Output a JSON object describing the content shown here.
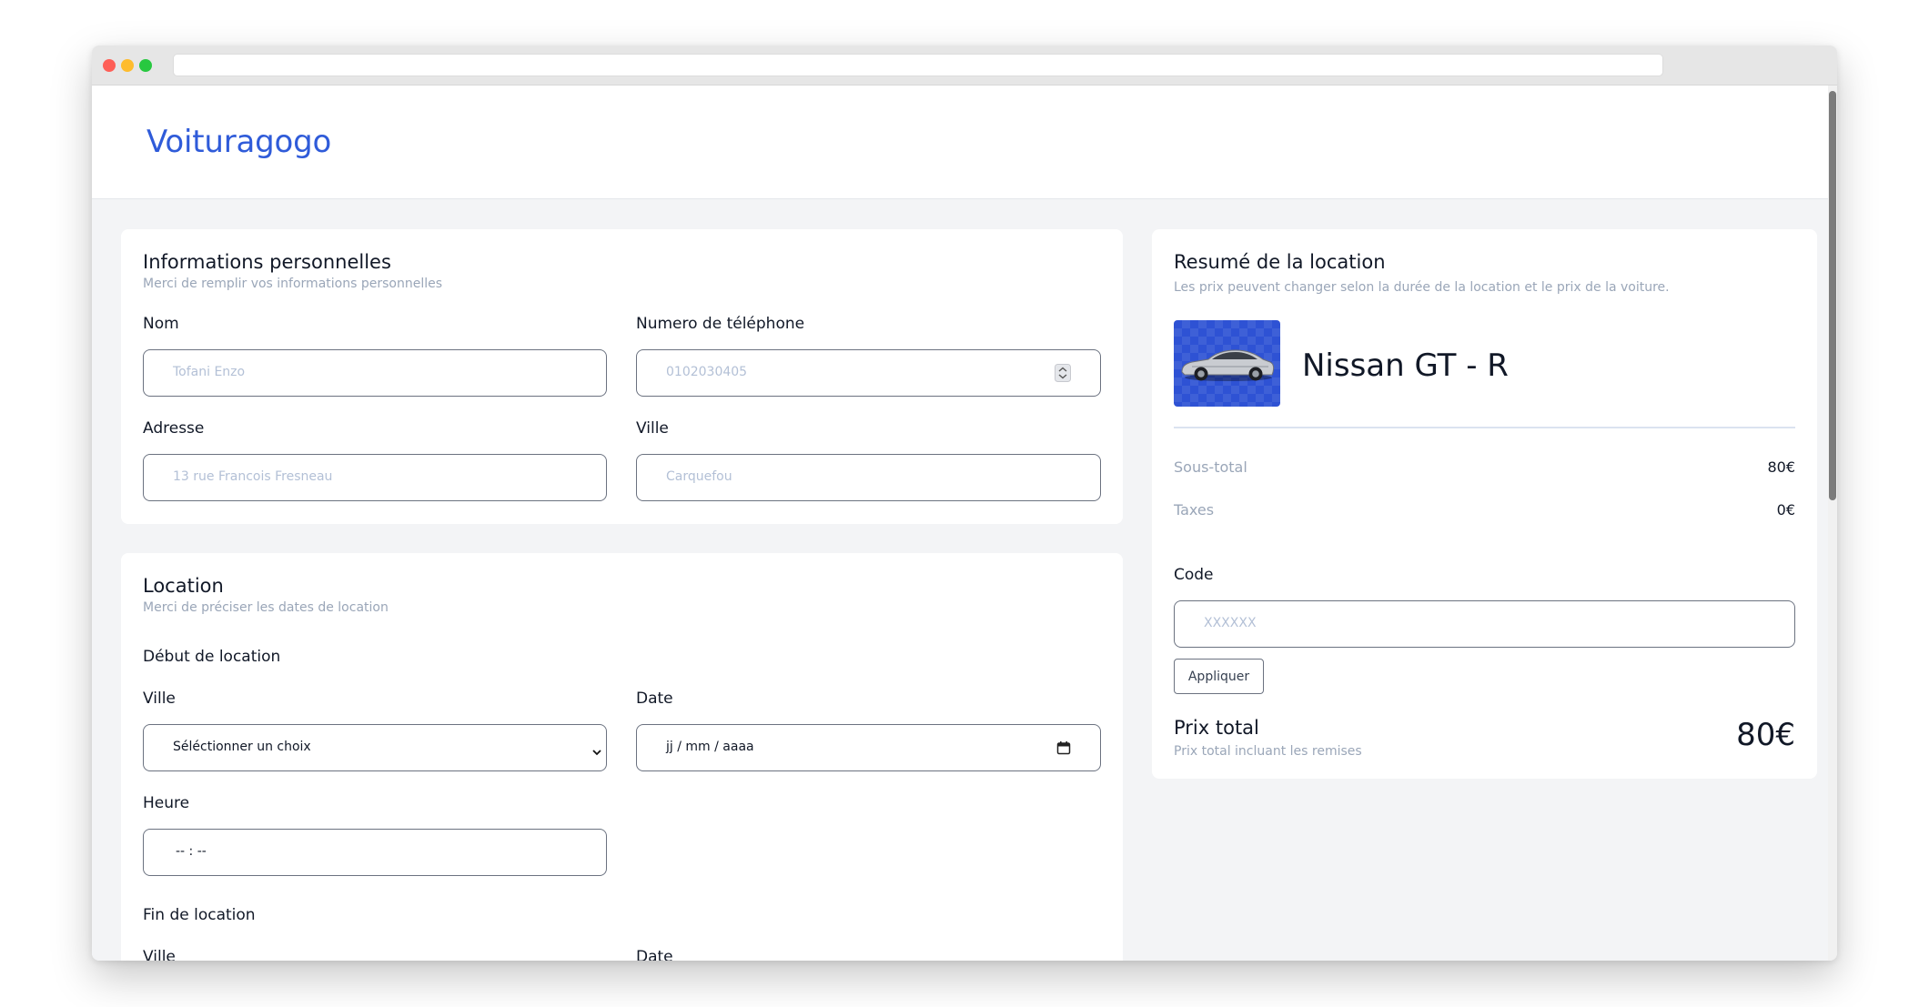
{
  "app": {
    "name": "Voituragogo",
    "brand_color": "#2f5bd9"
  },
  "personal": {
    "title": "Informations personnelles",
    "subtitle": "Merci de remplir vos informations personnelles",
    "fields": {
      "nom": {
        "label": "Nom",
        "placeholder": "Tofani Enzo"
      },
      "phone": {
        "label": "Numero de téléphone",
        "placeholder": "0102030405"
      },
      "adresse": {
        "label": "Adresse",
        "placeholder": "13 rue Francois Fresneau"
      },
      "ville": {
        "label": "Ville",
        "placeholder": "Carquefou"
      }
    }
  },
  "location": {
    "title": "Location",
    "subtitle": "Merci de préciser les dates de location",
    "start_heading": "Début de location",
    "start": {
      "ville_label": "Ville",
      "ville_value": "Séléctionner un choix",
      "date_label": "Date",
      "date_value": "jj / mm / aaaa",
      "heure_label": "Heure",
      "heure_value": "-- : --"
    },
    "end_heading": "Fin de location",
    "end": {
      "ville_label": "Ville",
      "date_label": "Date"
    }
  },
  "summary": {
    "title": "Resumé de la location",
    "subtitle": "Les prix peuvent changer selon la durée de la location et le prix de la voiture.",
    "car_name": "Nissan GT - R",
    "subtotal_label": "Sous-total",
    "subtotal_value": "80€",
    "taxes_label": "Taxes",
    "taxes_value": "0€",
    "code_label": "Code",
    "code_placeholder": "XXXXXX",
    "apply_label": "Appliquer",
    "total_label": "Prix total",
    "total_sub": "Prix total incluant les remises",
    "total_value": "80€"
  }
}
